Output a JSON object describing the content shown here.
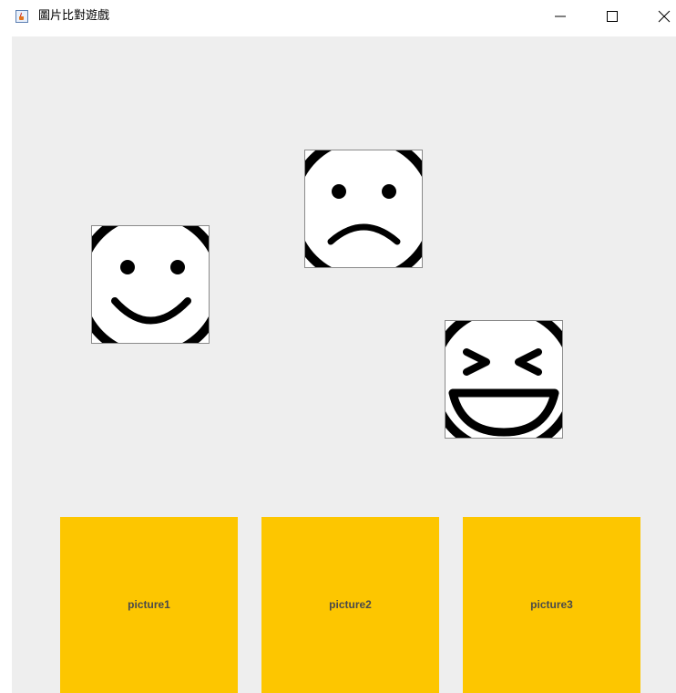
{
  "window": {
    "title": "圖片比對遊戲",
    "icon": "java-coffee-cup-icon",
    "controls": [
      "minimize-icon",
      "maximize-icon",
      "close-icon"
    ]
  },
  "faces": [
    {
      "name": "smiling-face",
      "icon": "smile-face-icon"
    },
    {
      "name": "sad-face",
      "icon": "sad-face-icon"
    },
    {
      "name": "laughing-face",
      "icon": "laughing-face-icon"
    }
  ],
  "cards": [
    {
      "label": "picture1"
    },
    {
      "label": "picture2"
    },
    {
      "label": "picture3"
    }
  ],
  "colors": {
    "card": "#fdc600",
    "content_bg": "#eeeeee",
    "card_text": "#4a4a4a"
  }
}
